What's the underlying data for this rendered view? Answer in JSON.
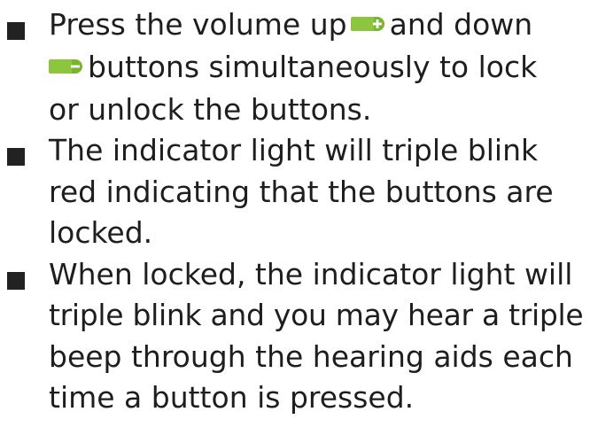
{
  "bullets": [
    {
      "lines": [
        "Press the volume up",
        "and down",
        "buttons simultaneously to lock",
        "or unlock the buttons."
      ]
    },
    {
      "lines": [
        "The indicator light will triple blink",
        "red indicating that the buttons are",
        "locked."
      ]
    },
    {
      "lines": [
        "When locked, the indicator light will",
        "triple blink and you may hear a triple",
        "beep through the hearing aids each",
        "time a button is pressed."
      ]
    }
  ],
  "icons": {
    "volume_up": "volume-up-button-icon",
    "volume_down": "volume-down-button-icon"
  },
  "colors": {
    "button_green": "#8cc63f",
    "text": "#1e1e1e"
  }
}
